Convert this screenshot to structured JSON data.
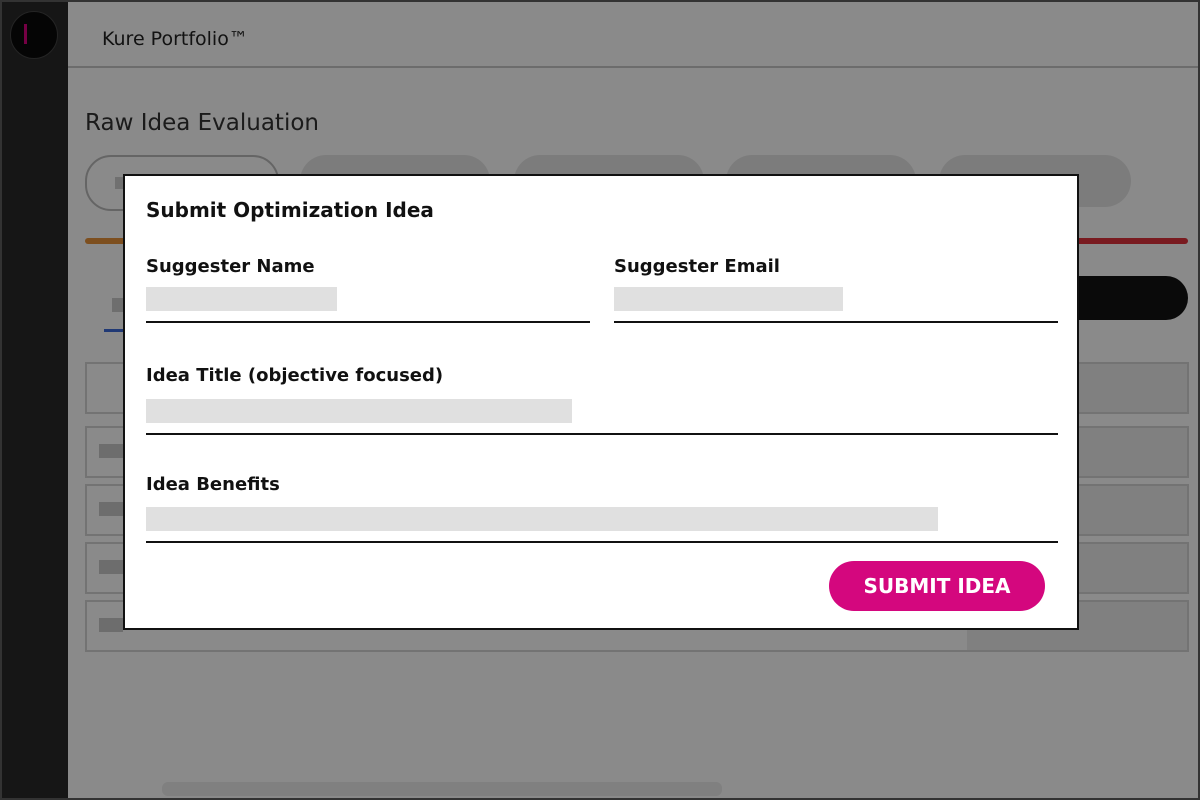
{
  "app": {
    "title": "Kure Portfolio™"
  },
  "page": {
    "heading": "Raw Idea Evaluation"
  },
  "modal": {
    "title": "Submit Optimization Idea",
    "fields": {
      "name_label": "Suggester Name",
      "email_label": "Suggester Email",
      "title_label": "Idea Title (objective focused)",
      "benefits_label": "Idea Benefits"
    },
    "submit_label": "SUBMIT IDEA"
  },
  "colors": {
    "accent": "#d4077e",
    "sidebar": "#2a2a2a",
    "progress_start": "#e8933a",
    "progress_end": "#e0333b"
  }
}
